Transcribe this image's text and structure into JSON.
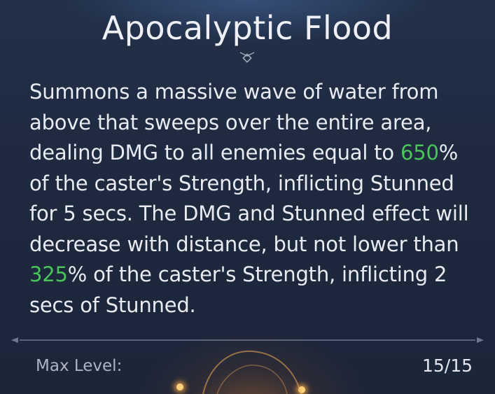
{
  "skill": {
    "title": "Apocalyptic Flood",
    "description": {
      "part1": "Summons a massive wave of water from above that sweeps over the entire area, dealing DMG to all enemies equal to ",
      "value1": "650",
      "part2": "% of the caster's Strength, inflicting Stunned for 5 secs. The DMG and Stunned effect will decrease with distance, but not lower than ",
      "value2": "325",
      "part3": "% of the caster's Strength, inflicting 2 secs of Stunned."
    },
    "max_level_label": "Max Level:",
    "max_level_value": "15/15"
  },
  "colors": {
    "highlight": "#49c35a",
    "background": "#1f2a40",
    "text": "#e8ebf2"
  },
  "icons": {
    "divider_ornament": "diamond-ornament-icon"
  }
}
